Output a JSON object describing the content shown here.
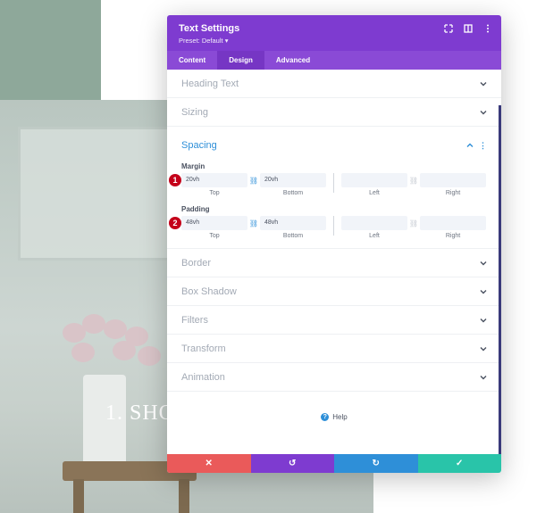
{
  "background": {
    "hero_text": "1. SHO"
  },
  "modal": {
    "title": "Text Settings",
    "preset": "Preset: Default ▾",
    "tabs": [
      {
        "label": "Content"
      },
      {
        "label": "Design",
        "active": true
      },
      {
        "label": "Advanced"
      }
    ],
    "sections_top": [
      "Heading Text",
      "Sizing"
    ],
    "spacing": {
      "label": "Spacing",
      "margin": {
        "label": "Margin",
        "top": "20vh",
        "bottom": "20vh",
        "left": "",
        "right": "",
        "captions": [
          "Top",
          "Bottom",
          "Left",
          "Right"
        ]
      },
      "padding": {
        "label": "Padding",
        "top": "48vh",
        "bottom": "48vh",
        "left": "",
        "right": "",
        "captions": [
          "Top",
          "Bottom",
          "Left",
          "Right"
        ]
      },
      "badges": [
        "1",
        "2"
      ]
    },
    "sections_bottom": [
      "Border",
      "Box Shadow",
      "Filters",
      "Transform",
      "Animation"
    ],
    "help_label": "Help",
    "footer": {
      "colors": {
        "cancel": "#ea5a5a",
        "undo": "#7e3bd0",
        "redo": "#2e8fd8",
        "save": "#29c4a9"
      }
    }
  },
  "colors": {
    "header": "#7e3bd0",
    "tabs": "#8a4ad6",
    "accent": "#2e8fd8"
  }
}
